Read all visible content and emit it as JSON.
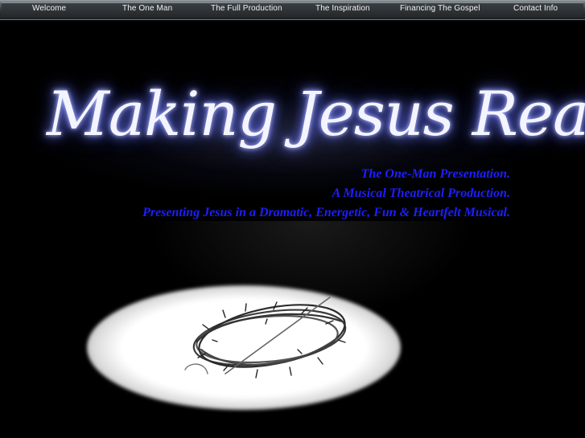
{
  "nav": {
    "items": [
      {
        "label": "Welcome"
      },
      {
        "label": "The One Man"
      },
      {
        "label": "The Full Production"
      },
      {
        "label": "The Inspiration"
      },
      {
        "label": "Financing The Gospel"
      },
      {
        "label": "Contact Info"
      }
    ]
  },
  "hero": {
    "title": "Making Jesus Real",
    "taglines": [
      "The One-Man Presentation.",
      "A Musical Theatrical Production.",
      "Presenting Jesus in a Dramatic, Energetic, Fun & Heartfelt Musical."
    ]
  },
  "colors": {
    "background": "#000000",
    "tagline": "#1e1eff",
    "title_glow": "#6f7cff"
  },
  "image": {
    "subject": "crown-of-thorns-icon"
  }
}
